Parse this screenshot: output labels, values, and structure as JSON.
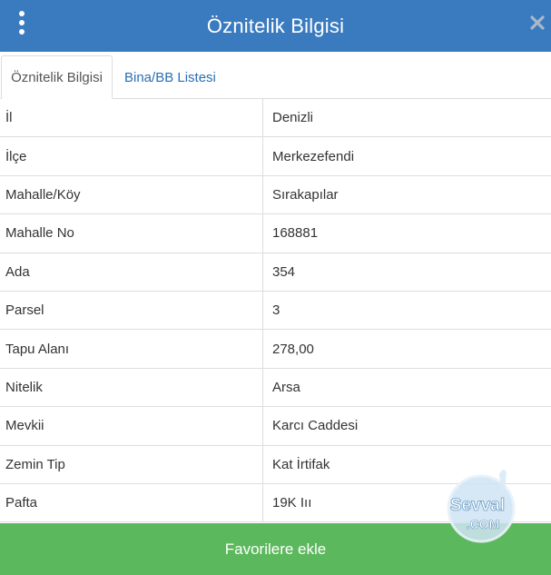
{
  "header": {
    "title": "Öznitelik Bilgisi",
    "color": "#3a7bbf"
  },
  "icons": {
    "menu": "vertical-dots-icon",
    "close": "close-icon"
  },
  "tabs": [
    {
      "label": "Öznitelik Bilgisi",
      "active": true
    },
    {
      "label": "Bina/BB Listesi",
      "active": false
    }
  ],
  "rows": [
    {
      "label": "İl",
      "value": "Denizli"
    },
    {
      "label": "İlçe",
      "value": "Merkezefendi"
    },
    {
      "label": "Mahalle/Köy",
      "value": "Sırakapılar"
    },
    {
      "label": "Mahalle No",
      "value": "168881"
    },
    {
      "label": "Ada",
      "value": "354"
    },
    {
      "label": "Parsel",
      "value": "3"
    },
    {
      "label": "Tapu Alanı",
      "value": "278,00"
    },
    {
      "label": "Nitelik",
      "value": "Arsa"
    },
    {
      "label": "Mevkii",
      "value": "Karcı Caddesi"
    },
    {
      "label": "Zemin Tip",
      "value": "Kat İrtifak"
    },
    {
      "label": "Pafta",
      "value": "19K Iıı"
    }
  ],
  "footer": {
    "button_label": "Favorilere ekle",
    "color": "#5cb85c"
  },
  "watermark": {
    "line1": "Sevval",
    "line2": ".COM"
  }
}
